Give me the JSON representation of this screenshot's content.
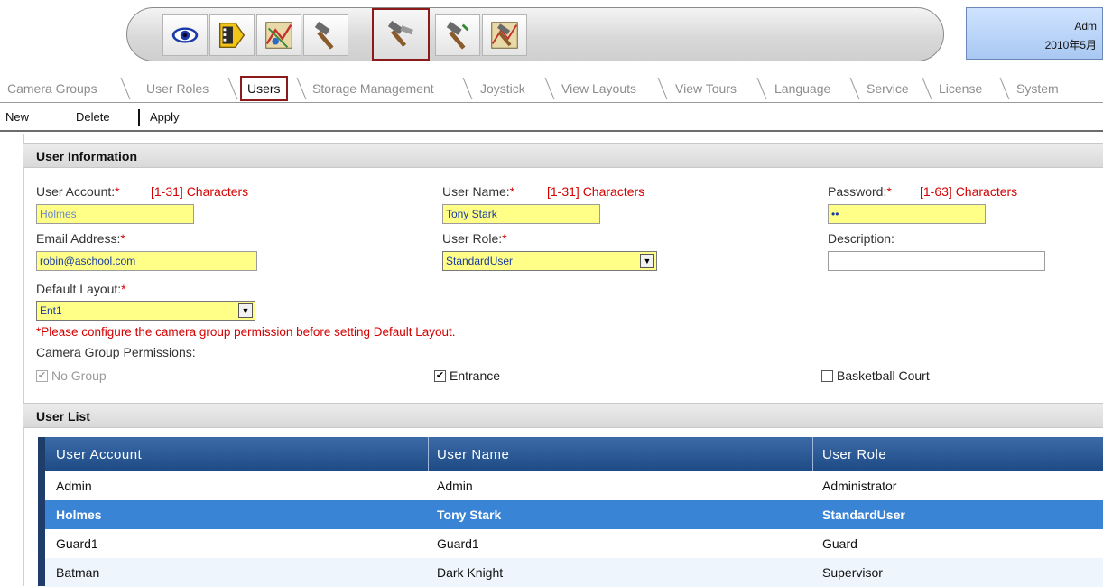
{
  "toolbar": {
    "tools": [
      {
        "icon": "eye-icon",
        "tooltip": ""
      },
      {
        "icon": "playback-film-icon",
        "tooltip": ""
      },
      {
        "icon": "map-layout-icon",
        "tooltip": ""
      },
      {
        "icon": "hammer-tool-icon",
        "tooltip": ""
      },
      {
        "icon": "setup-tools-icon",
        "tooltip": ""
      },
      {
        "icon": "hammer-wrench-icon",
        "tooltip": ""
      },
      {
        "icon": "tools-settings-icon",
        "tooltip": ""
      }
    ],
    "selected_index": 4
  },
  "session": {
    "user": "Adm",
    "date": "2010年5月"
  },
  "tabs": [
    {
      "label": "Camera Groups"
    },
    {
      "label": "User Roles"
    },
    {
      "label": "Users"
    },
    {
      "label": "Storage Management"
    },
    {
      "label": "Joystick"
    },
    {
      "label": "View Layouts"
    },
    {
      "label": "View Tours"
    },
    {
      "label": "Language"
    },
    {
      "label": "Service"
    },
    {
      "label": "License"
    },
    {
      "label": "System"
    }
  ],
  "active_tab": "Users",
  "actions": {
    "new": "New",
    "delete": "Delete",
    "apply": "Apply"
  },
  "user_info": {
    "title": "User Information",
    "account_label": "User Account:",
    "account_hint": "[1-31] Characters",
    "account_value": "Holmes",
    "name_label": "User Name:",
    "name_hint": "[1-31] Characters",
    "name_value": "Tony Stark",
    "password_label": "Password:",
    "password_hint": "[1-63] Characters",
    "password_value": "••",
    "email_label": "Email Address:",
    "email_value": "robin@aschool.com",
    "role_label": "User Role:",
    "role_value": "StandardUser",
    "description_label": "Description:",
    "description_value": "",
    "layout_label": "Default Layout:",
    "layout_value": "Ent1",
    "required_mark": "*",
    "warning": "*Please configure the camera group permission before setting Default Layout.",
    "permissions_label": "Camera Group Permissions:",
    "permissions": [
      {
        "label": "No Group",
        "checked": true,
        "disabled": true
      },
      {
        "label": "Entrance",
        "checked": true,
        "disabled": false
      },
      {
        "label": "Basketball Court",
        "checked": false,
        "disabled": false
      }
    ]
  },
  "user_list": {
    "title": "User List",
    "columns": [
      "User Account",
      "User Name",
      "User Role"
    ],
    "rows": [
      {
        "account": "Admin",
        "name": "Admin",
        "role": "Administrator",
        "selected": false
      },
      {
        "account": "Holmes",
        "name": "Tony Stark",
        "role": "StandardUser",
        "selected": true
      },
      {
        "account": "Guard1",
        "name": "Guard1",
        "role": "Guard",
        "selected": false
      },
      {
        "account": "Batman",
        "name": "Dark Knight",
        "role": "Supervisor",
        "selected": false
      }
    ]
  }
}
